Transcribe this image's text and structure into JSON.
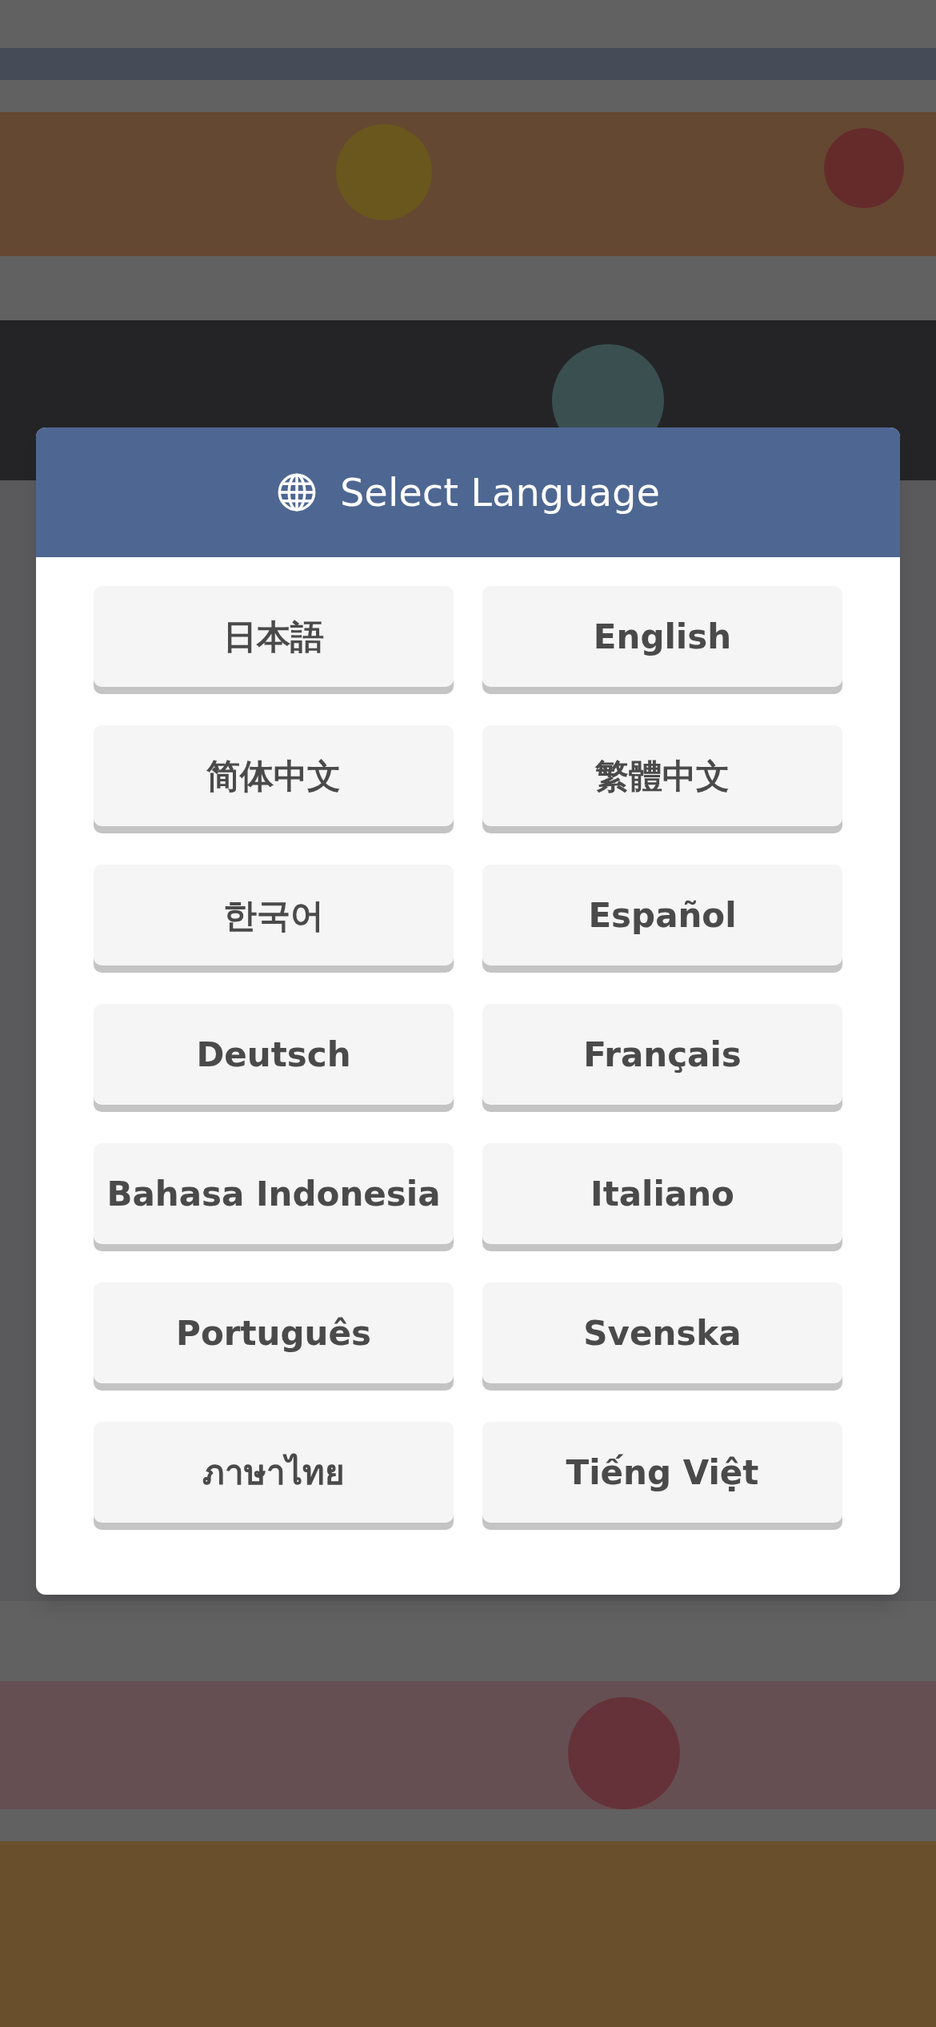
{
  "dialog": {
    "title": "Select Language",
    "languages": [
      {
        "label": "日本語"
      },
      {
        "label": "English"
      },
      {
        "label": "简体中文"
      },
      {
        "label": "繁體中文"
      },
      {
        "label": "한국어"
      },
      {
        "label": "Español"
      },
      {
        "label": "Deutsch"
      },
      {
        "label": "Français"
      },
      {
        "label": "Bahasa Indonesia"
      },
      {
        "label": "Italiano"
      },
      {
        "label": "Português"
      },
      {
        "label": "Svenska"
      },
      {
        "label": "ภาษาไทย"
      },
      {
        "label": "Tiếng Việt"
      }
    ]
  }
}
